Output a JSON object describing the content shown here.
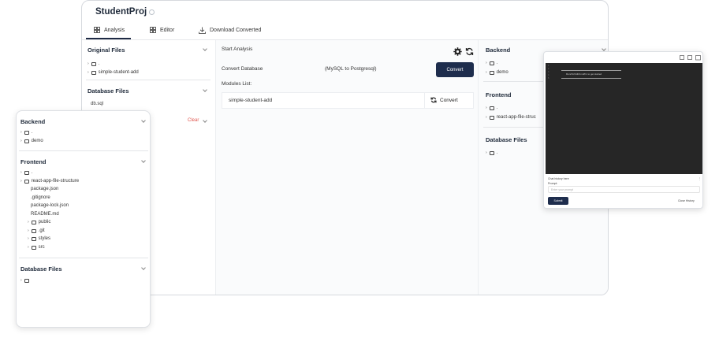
{
  "project": {
    "title": "StudentProj"
  },
  "tabs": [
    {
      "label": "Analysis",
      "icon": "grid-icon",
      "active": true
    },
    {
      "label": "Editor",
      "icon": "grid-icon",
      "active": false
    },
    {
      "label": "Download Converted",
      "icon": "download-icon",
      "active": false
    }
  ],
  "left_column": {
    "original_files_title": "Original Files",
    "original_files": [
      ".",
      "simple-student-add"
    ],
    "database_files_title": "Database Files",
    "database_files": [
      "db.sql"
    ],
    "clear_label": "Clear"
  },
  "center": {
    "start_analysis": "Start Analysis",
    "convert_database": "Convert Database",
    "db_conversion": "(MySQL to Postgresql)",
    "convert_button": "Convert",
    "modules_list": "Modules List:",
    "modules": [
      {
        "name": "simple-student-add",
        "action": "Convert"
      }
    ]
  },
  "right_column": {
    "backend_title": "Backend",
    "backend_items": [
      ".",
      "demo"
    ],
    "frontend_title": "Frontend",
    "frontend_items": [
      ".",
      "react-app-file-struc"
    ],
    "database_title": "Database Files",
    "database_items": [
      "."
    ]
  },
  "left_panel": {
    "backend_title": "Backend",
    "backend_items": [
      ".",
      "demo"
    ],
    "frontend_title": "Frontend",
    "frontend_items": [
      ".",
      "react-app-file-structure",
      "package.json",
      ".gitignore",
      "package-lock.json",
      "README.md",
      "public",
      ".git",
      "styles",
      "src"
    ],
    "database_title": "Database Files",
    "database_items": [
      ""
    ]
  },
  "editor_panel": {
    "code_line": "Run/Ctrl/Alt/Cmd/Fn to get started",
    "chat_history_label": "Chat history here",
    "prompt_label": "Prompt:",
    "prompt_placeholder": "Enter your prompt",
    "submit_label": "Submit",
    "close_label": "Close History"
  },
  "colors": {
    "primary": "#1e2d4d",
    "clear": "#e0554e",
    "editor_bg": "#262626"
  }
}
